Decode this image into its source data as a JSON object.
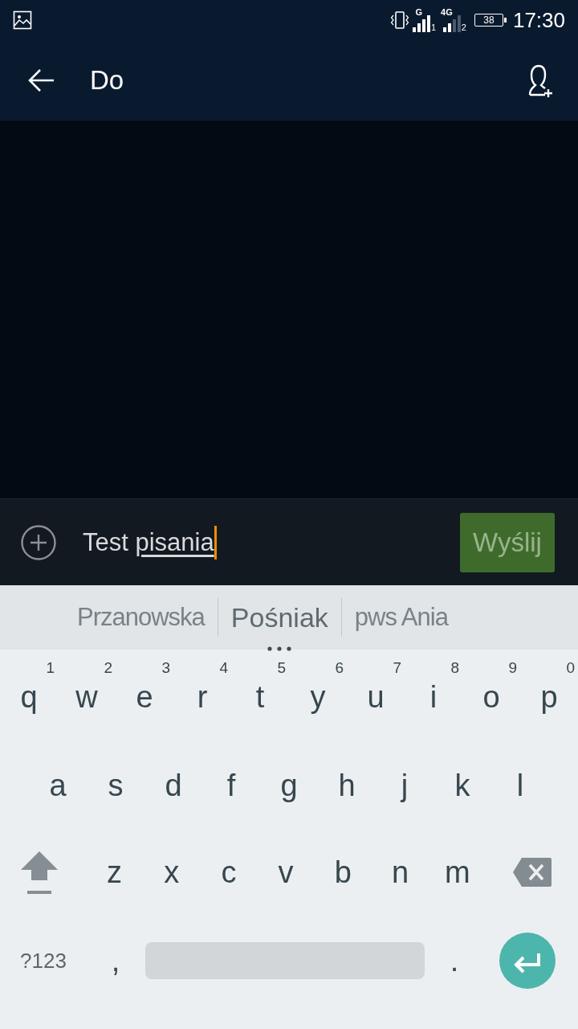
{
  "status_bar": {
    "sims": [
      {
        "network": "G",
        "slot": "1"
      },
      {
        "network": "4G",
        "slot": "2"
      }
    ],
    "battery": "38",
    "time": "17:30"
  },
  "app_bar": {
    "title": "Do"
  },
  "compose": {
    "text": "Test ",
    "composing": "pisania",
    "send_label": "Wyślij"
  },
  "suggestions": [
    {
      "label": "Przanowska",
      "selected": false
    },
    {
      "label": "Pośniak",
      "selected": true
    },
    {
      "label": "pws Ania",
      "selected": false
    }
  ],
  "keyboard": {
    "rows": [
      [
        {
          "kind": "letter",
          "label": "q",
          "hint": "1"
        },
        {
          "kind": "letter",
          "label": "w",
          "hint": "2"
        },
        {
          "kind": "letter",
          "label": "e",
          "hint": "3"
        },
        {
          "kind": "letter",
          "label": "r",
          "hint": "4"
        },
        {
          "kind": "letter",
          "label": "t",
          "hint": "5"
        },
        {
          "kind": "letter",
          "label": "y",
          "hint": "6"
        },
        {
          "kind": "letter",
          "label": "u",
          "hint": "7"
        },
        {
          "kind": "letter",
          "label": "i",
          "hint": "8"
        },
        {
          "kind": "letter",
          "label": "o",
          "hint": "9"
        },
        {
          "kind": "letter",
          "label": "p",
          "hint": "0"
        }
      ],
      [
        {
          "kind": "letter",
          "label": "a"
        },
        {
          "kind": "letter",
          "label": "s"
        },
        {
          "kind": "letter",
          "label": "d"
        },
        {
          "kind": "letter",
          "label": "f"
        },
        {
          "kind": "letter",
          "label": "g"
        },
        {
          "kind": "letter",
          "label": "h"
        },
        {
          "kind": "letter",
          "label": "j"
        },
        {
          "kind": "letter",
          "label": "k"
        },
        {
          "kind": "letter",
          "label": "l"
        }
      ],
      [
        {
          "kind": "shift"
        },
        {
          "kind": "letter",
          "label": "z"
        },
        {
          "kind": "letter",
          "label": "x"
        },
        {
          "kind": "letter",
          "label": "c"
        },
        {
          "kind": "letter",
          "label": "v"
        },
        {
          "kind": "letter",
          "label": "b"
        },
        {
          "kind": "letter",
          "label": "n"
        },
        {
          "kind": "letter",
          "label": "m"
        },
        {
          "kind": "backspace"
        }
      ]
    ],
    "bottom_row": {
      "symbols_key": "?123",
      "comma_key": ",",
      "period_key": "."
    }
  }
}
